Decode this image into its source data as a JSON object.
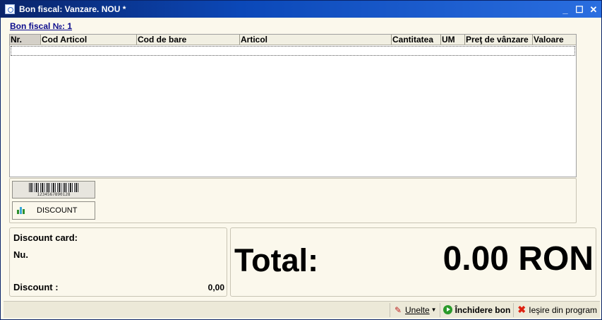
{
  "window": {
    "title": "Bon fiscal: Vanzare. NOU *"
  },
  "bon_link": "Bon fiscal №: 1",
  "grid": {
    "columns": [
      "Nr.",
      "Cod Articol",
      "Cod de bare",
      "Articol",
      "Cantitatea",
      "UM",
      "Preţ de vânzare",
      "Valoare"
    ],
    "rows": []
  },
  "actions": {
    "barcode_digits": "1234567890128",
    "discount_label": "DISCOUNT"
  },
  "card": {
    "discount_card_label": "Discount card:",
    "nu_label": "Nu.",
    "discount_label": "Discount :",
    "discount_value": "0,00"
  },
  "total": {
    "label": "Total:",
    "value": "0.00 RON"
  },
  "statusbar": {
    "tools_label": "Unelte",
    "close_label": "Închidere bon",
    "exit_label": "Ieşire din program"
  }
}
